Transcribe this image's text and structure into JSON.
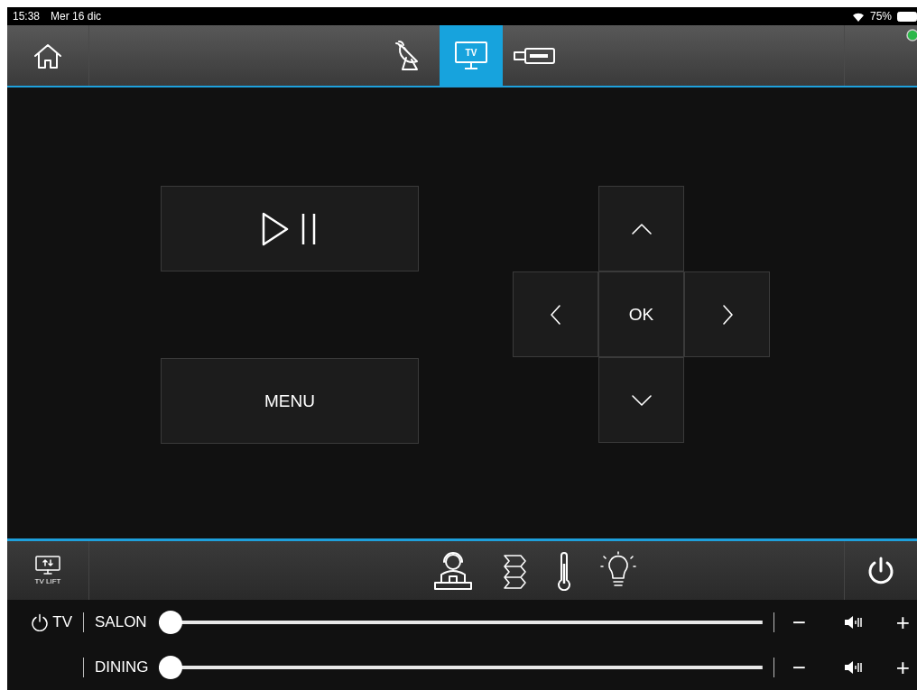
{
  "status_bar": {
    "time": "15:38",
    "date": "Mer 16 dic",
    "battery": "75%"
  },
  "tabs": [
    {
      "kind": "satellite",
      "selected": false
    },
    {
      "kind": "tv",
      "label": "TV",
      "selected": true
    },
    {
      "kind": "hdmi",
      "selected": false
    }
  ],
  "remote": {
    "play_pause": {
      "kind": "playpause"
    },
    "menu": "MENU",
    "dpad": {
      "ok": "OK"
    }
  },
  "bottom_bar": {
    "tv_lift": "TV LIFT",
    "icons": [
      {
        "kind": "person"
      },
      {
        "kind": "blinds"
      },
      {
        "kind": "thermometer"
      },
      {
        "kind": "bulb"
      }
    ]
  },
  "zones": [
    {
      "power_label": "TV",
      "name": "SALON",
      "level": 0,
      "minus": "−",
      "plus": "+"
    },
    {
      "name": "DINING",
      "level": 0,
      "minus": "−",
      "plus": "+"
    }
  ]
}
